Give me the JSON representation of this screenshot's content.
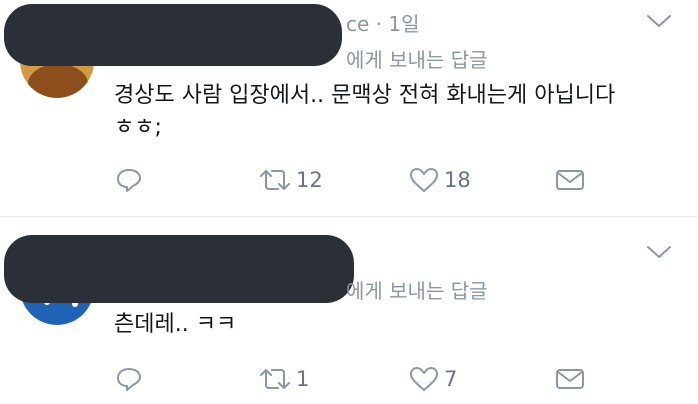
{
  "tweets": [
    {
      "meta": "ce · 1일",
      "replying": "에게 보내는 답글",
      "text_line1": "경상도 사람 입장에서.. 문맥상 전혀 화내는게 아닙니다",
      "text_line2": "ㅎㅎ;",
      "retweets": "12",
      "likes": "18"
    },
    {
      "meta": "",
      "replying": "에게 보내는 답글",
      "text_line1": "츤데레.. ㅋㅋ",
      "text_line2": "",
      "retweets": "1",
      "likes": "7"
    }
  ],
  "icons": {
    "reply": "reply-icon",
    "retweet": "retweet-icon",
    "like": "heart-icon",
    "dm": "envelope-icon",
    "more": "chevron-down-icon"
  },
  "colors": {
    "muted": "#8899a6",
    "text": "#14171a",
    "divider": "#e6ecf0",
    "redaction": "#2b3038"
  }
}
